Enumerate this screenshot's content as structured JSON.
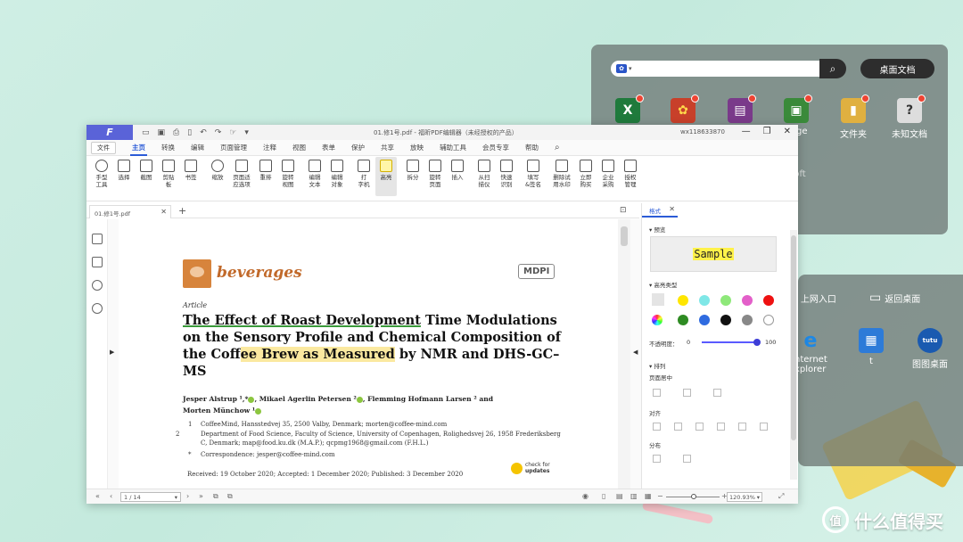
{
  "desktop": {
    "search_button_icon": "search-icon",
    "desktop_docs_button": "桌面文档",
    "icons_row1": [
      {
        "label": "",
        "glyph": "X",
        "color": "#1f7a3c"
      },
      {
        "label": "",
        "glyph": "✿",
        "color": "#c8402a"
      },
      {
        "label": "",
        "glyph": "▤",
        "color": "#7a3a8a"
      },
      {
        "label": "nage",
        "glyph": "▣",
        "color": "#3a8a3a"
      },
      {
        "label": "文件夹",
        "glyph": "▮",
        "color": "#e0b040"
      },
      {
        "label": "未知文档",
        "glyph": "?",
        "color": "#dddddd"
      }
    ],
    "partial_icon_label": "osoft\nd...",
    "panel2_items": [
      {
        "label": "上网入口",
        "glyph": "⌂"
      },
      {
        "label": "返回桌面",
        "glyph": "▭"
      },
      {
        "label": "nternet\nxplorer",
        "glyph": "e"
      },
      {
        "label": "t",
        "glyph": "▦"
      },
      {
        "label": "图图桌面",
        "glyph": "tutu"
      }
    ]
  },
  "watermark": {
    "ring": "值",
    "text": "什么值得买"
  },
  "window": {
    "title": "01.修1号.pdf - 福昕PDF编辑器（未经授权的产品）",
    "user": "wx118633870",
    "menus": [
      "文件",
      "主页",
      "转换",
      "编辑",
      "页面管理",
      "注释",
      "视图",
      "表单",
      "保护",
      "共享",
      "放映",
      "辅助工具",
      "会员专享",
      "帮助"
    ],
    "active_menu": "主页",
    "toolbar": [
      "手型\n工具",
      "选择",
      "截图",
      "剪贴\n板",
      "书签",
      "缩放",
      "页面适\n应选项",
      "重排",
      "旋转\n视图",
      "编辑\n文本",
      "编辑\n对象",
      "打\n字机",
      "高亮",
      "拆分",
      "旋转\n页面",
      "插入",
      "从扫\n描仪",
      "快速\n识别",
      "填写\n&签名",
      "删除试\n用水印",
      "立即\n购买",
      "企业\n采购",
      "授权\n管理"
    ],
    "doc_tab": "01.修1号.pdf"
  },
  "document": {
    "journal": "beverages",
    "publisher": "MDPI",
    "article_label": "Article",
    "title_parts": {
      "a": "The Effect of Roast Development",
      "b": " Time Modulations on the Sensory Profile and Chemical Composition of the Coff",
      "c": "ee Brew as Measured",
      "d": " by NMR and DHS-GC–MS"
    },
    "authors_line1": "Jesper Alstrup ¹,*",
    "authors_line1b": ", Mikael Agerlin Petersen ²",
    "authors_line1c": ", Flemming Hofmann Larsen ² and",
    "authors_line2": "Morten Münchow ¹",
    "affiliations": [
      {
        "n": "1",
        "text": "CoffeeMind, Hansstedvej 35, 2500 Valby, Denmark; morten@coffee-mind.com"
      },
      {
        "n": "2",
        "text": "Department of Food Science, Faculty of Science, University of Copenhagen, Rolighedsvej 26, 1958 Frederiksberg C, Denmark; map@food.ku.dk (M.A.P.); qcpmg1968@gmail.com (F.H.L.)"
      },
      {
        "n": "*",
        "text": "Correspondence: jesper@coffee-mind.com"
      }
    ],
    "received": "Received: 19 October 2020; Accepted: 1 December 2020; Published: 3 December 2020",
    "check_for": "check for",
    "updates": "updates"
  },
  "format_panel": {
    "tab": "格式",
    "preview": "预览",
    "sample": "Sample",
    "highlight_type": "高亮类型",
    "colors_row1": [
      "#ffe600",
      "#7fe7e7",
      "#8ee87a",
      "#e35fc9",
      "#ee1111"
    ],
    "colors_row2": [
      "#2e8b22",
      "#2f6be0",
      "#111111",
      "#888888",
      "#ffffff"
    ],
    "opacity_label": "不透明度：",
    "opacity_min": "0",
    "opacity_max": "100",
    "opacity_value": 100,
    "arrange": "排列",
    "page_center": "页面居中",
    "align": "对齐",
    "distribute": "分布"
  },
  "statusbar": {
    "page": "1 / 14",
    "zoom": "120.93%"
  }
}
